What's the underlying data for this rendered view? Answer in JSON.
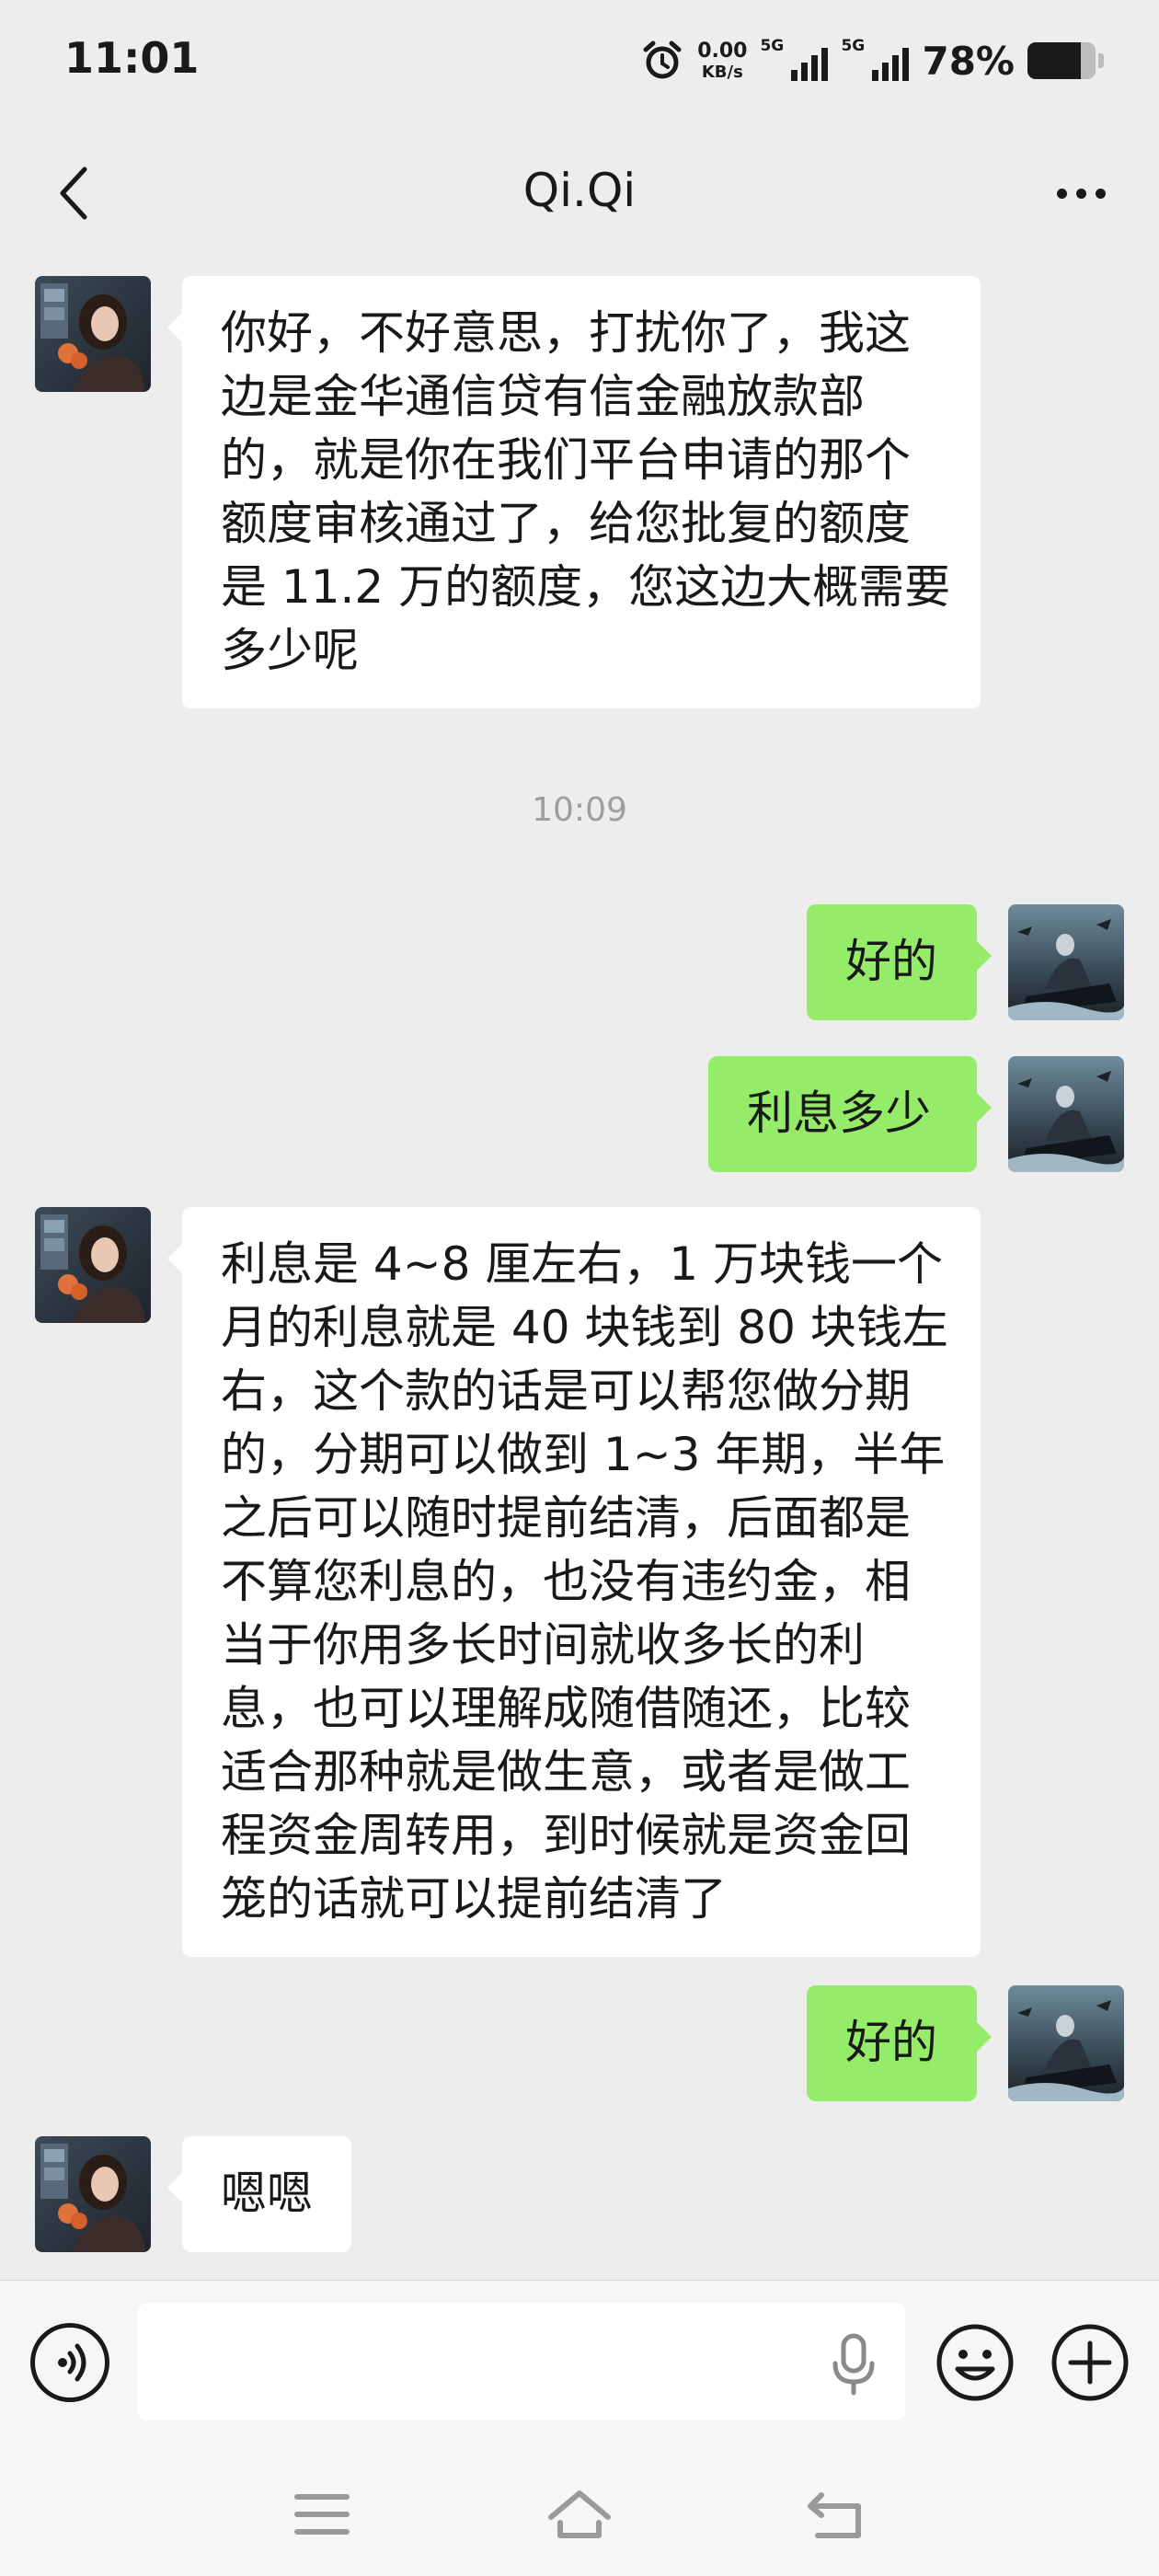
{
  "status_bar": {
    "time": "11:01",
    "net_speed_value": "0.00",
    "net_speed_unit": "KB/s",
    "signal_1_label": "5G",
    "signal_2_label": "5G",
    "battery_percent": "78%",
    "battery_level": 0.78
  },
  "header": {
    "title": "Qi.Qi"
  },
  "messages": [
    {
      "side": "incoming",
      "lines": [
        "你好，不好意思，打扰你了，我这",
        "边是金华通信贷有信金融放款部",
        "的，就是你在我们平台申请的那个",
        "额度审核通过了，给您批复的额度",
        "是 11.2 万的额度，您这边大概需要",
        "多少呢"
      ]
    },
    {
      "side": "outgoing",
      "lines": [
        "好的"
      ]
    },
    {
      "side": "outgoing",
      "lines": [
        "利息多少"
      ]
    },
    {
      "side": "incoming",
      "lines": [
        "利息是 4~8 厘左右，1 万块钱一个",
        "月的利息就是 40 块钱到 80 块钱左",
        "右，这个款的话是可以帮您做分期",
        "的，分期可以做到 1~3 年期，半年",
        "之后可以随时提前结清，后面都是",
        "不算您利息的，也没有违约金，相",
        "当于你用多长时间就收多长的利",
        "息，也可以理解成随借随还，比较",
        "适合那种就是做生意，或者是做工",
        "程资金周转用，到时候就是资金回",
        "笼的话就可以提前结清了"
      ]
    },
    {
      "side": "outgoing",
      "lines": [
        "好的"
      ]
    },
    {
      "side": "incoming",
      "lines": [
        "嗯嗯"
      ]
    }
  ],
  "timestamp": "10:09",
  "input_bar": {
    "value": "",
    "placeholder": ""
  },
  "icons": {
    "back": "chevron-left-icon",
    "more": "more-dots-icon",
    "voice": "voice-mode-icon",
    "mic": "microphone-icon",
    "emoji": "emoji-icon",
    "plus": "plus-icon",
    "nav_menu": "menu-icon",
    "nav_home": "home-icon",
    "nav_back": "return-icon"
  },
  "colors": {
    "background": "#EDEDED",
    "incoming_bubble": "#FFFFFF",
    "outgoing_bubble": "#95EC69",
    "timestamp_text": "#9E9E9E"
  }
}
